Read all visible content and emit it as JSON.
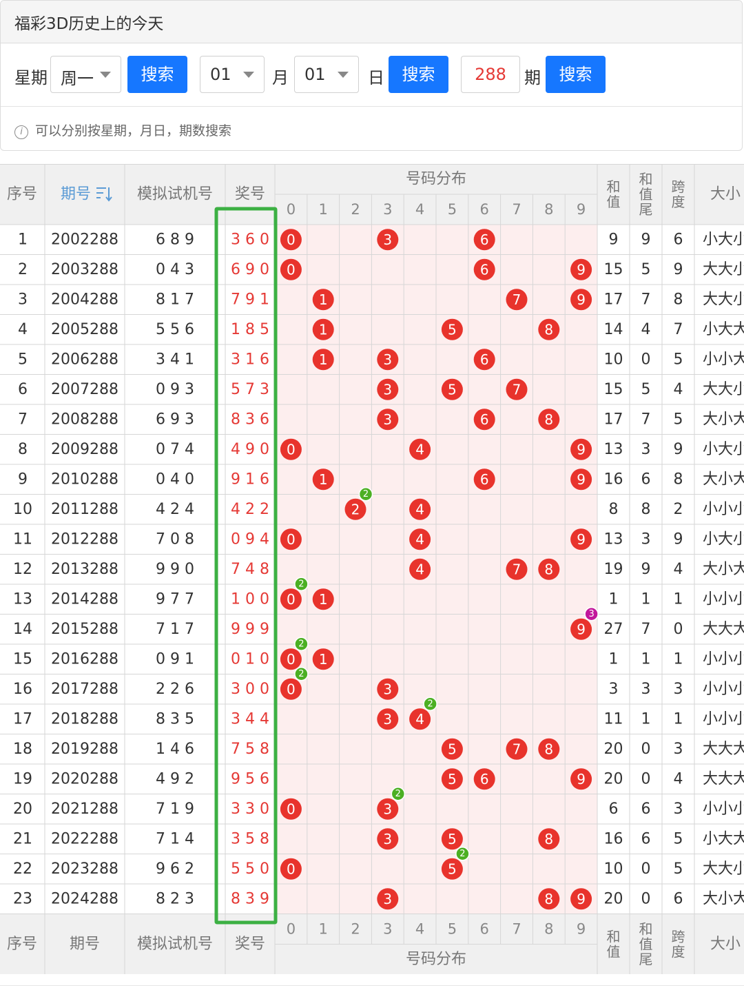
{
  "page": {
    "title": "福彩3D历史上的今天"
  },
  "search": {
    "weekday_label": "星期",
    "weekday_value": "周一",
    "search_btn": "搜索",
    "month_value": "01",
    "month_label": "月",
    "day_value": "01",
    "day_label": "日",
    "issue_value": "288",
    "issue_label": "期",
    "hint": "可以分别按星期，月日，期数搜索"
  },
  "table": {
    "headers": {
      "seq": "序号",
      "issue": "期号",
      "issue_sort_icon": "sort-icon",
      "trial": "模拟试机号",
      "winning": "奖号",
      "distribution": "号码分布",
      "digits": [
        "0",
        "1",
        "2",
        "3",
        "4",
        "5",
        "6",
        "7",
        "8",
        "9"
      ],
      "sum": "和值",
      "sum_tail": "和值尾",
      "span": "跨度",
      "size": "大小"
    },
    "rows": [
      {
        "seq": "1",
        "issue": "2002288",
        "trial": "6 8 9",
        "win": "3 6 0",
        "sum": "9",
        "tail": "9",
        "span": "6",
        "size": "小大小"
      },
      {
        "seq": "2",
        "issue": "2003288",
        "trial": "0 4 3",
        "win": "6 9 0",
        "sum": "15",
        "tail": "5",
        "span": "9",
        "size": "大大小"
      },
      {
        "seq": "3",
        "issue": "2004288",
        "trial": "8 1 7",
        "win": "7 9 1",
        "sum": "17",
        "tail": "7",
        "span": "8",
        "size": "大大小"
      },
      {
        "seq": "4",
        "issue": "2005288",
        "trial": "5 5 6",
        "win": "1 8 5",
        "sum": "14",
        "tail": "4",
        "span": "7",
        "size": "小大大"
      },
      {
        "seq": "5",
        "issue": "2006288",
        "trial": "3 4 1",
        "win": "3 1 6",
        "sum": "10",
        "tail": "0",
        "span": "5",
        "size": "小小大"
      },
      {
        "seq": "6",
        "issue": "2007288",
        "trial": "0 9 3",
        "win": "5 7 3",
        "sum": "15",
        "tail": "5",
        "span": "4",
        "size": "大大小"
      },
      {
        "seq": "7",
        "issue": "2008288",
        "trial": "6 9 3",
        "win": "8 3 6",
        "sum": "17",
        "tail": "7",
        "span": "5",
        "size": "大小大"
      },
      {
        "seq": "8",
        "issue": "2009288",
        "trial": "0 7 4",
        "win": "4 9 0",
        "sum": "13",
        "tail": "3",
        "span": "9",
        "size": "小大小"
      },
      {
        "seq": "9",
        "issue": "2010288",
        "trial": "0 4 0",
        "win": "9 1 6",
        "sum": "16",
        "tail": "6",
        "span": "8",
        "size": "大小大"
      },
      {
        "seq": "10",
        "issue": "2011288",
        "trial": "4 2 4",
        "win": "4 2 2",
        "sum": "8",
        "tail": "8",
        "span": "2",
        "size": "小小小"
      },
      {
        "seq": "11",
        "issue": "2012288",
        "trial": "7 0 8",
        "win": "0 9 4",
        "sum": "13",
        "tail": "3",
        "span": "9",
        "size": "小大小"
      },
      {
        "seq": "12",
        "issue": "2013288",
        "trial": "9 9 0",
        "win": "7 4 8",
        "sum": "19",
        "tail": "9",
        "span": "4",
        "size": "大小大"
      },
      {
        "seq": "13",
        "issue": "2014288",
        "trial": "9 7 7",
        "win": "1 0 0",
        "sum": "1",
        "tail": "1",
        "span": "1",
        "size": "小小小"
      },
      {
        "seq": "14",
        "issue": "2015288",
        "trial": "7 1 7",
        "win": "9 9 9",
        "sum": "27",
        "tail": "7",
        "span": "0",
        "size": "大大大"
      },
      {
        "seq": "15",
        "issue": "2016288",
        "trial": "0 9 1",
        "win": "0 1 0",
        "sum": "1",
        "tail": "1",
        "span": "1",
        "size": "小小小"
      },
      {
        "seq": "16",
        "issue": "2017288",
        "trial": "2 2 6",
        "win": "3 0 0",
        "sum": "3",
        "tail": "3",
        "span": "3",
        "size": "小小小"
      },
      {
        "seq": "17",
        "issue": "2018288",
        "trial": "8 3 5",
        "win": "3 4 4",
        "sum": "11",
        "tail": "1",
        "span": "1",
        "size": "小小小"
      },
      {
        "seq": "18",
        "issue": "2019288",
        "trial": "1 4 6",
        "win": "7 5 8",
        "sum": "20",
        "tail": "0",
        "span": "3",
        "size": "大大大"
      },
      {
        "seq": "19",
        "issue": "2020288",
        "trial": "4 9 2",
        "win": "9 5 6",
        "sum": "20",
        "tail": "0",
        "span": "4",
        "size": "大大大"
      },
      {
        "seq": "20",
        "issue": "2021288",
        "trial": "7 1 9",
        "win": "3 3 0",
        "sum": "6",
        "tail": "6",
        "span": "3",
        "size": "小小小"
      },
      {
        "seq": "21",
        "issue": "2022288",
        "trial": "7 1 4",
        "win": "3 5 8",
        "sum": "16",
        "tail": "6",
        "span": "5",
        "size": "小大大"
      },
      {
        "seq": "22",
        "issue": "2023288",
        "trial": "9 6 2",
        "win": "5 5 0",
        "sum": "10",
        "tail": "0",
        "span": "5",
        "size": "大大小"
      },
      {
        "seq": "23",
        "issue": "2024288",
        "trial": "8 2 3",
        "win": "8 3 9",
        "sum": "20",
        "tail": "0",
        "span": "6",
        "size": "大小大"
      }
    ]
  },
  "colors": {
    "accent": "#1677ff",
    "ball_red": "#e8332c",
    "repeat2_badge": "#4caf23",
    "repeat3_badge": "#c2179b",
    "highlight_box": "#3cb043",
    "dist_bg": "#fdeeee",
    "header_bg": "#f0f0f0",
    "border": "#d6d6d6",
    "win_text": "#e53935",
    "sort_link": "#5b9bd5"
  }
}
